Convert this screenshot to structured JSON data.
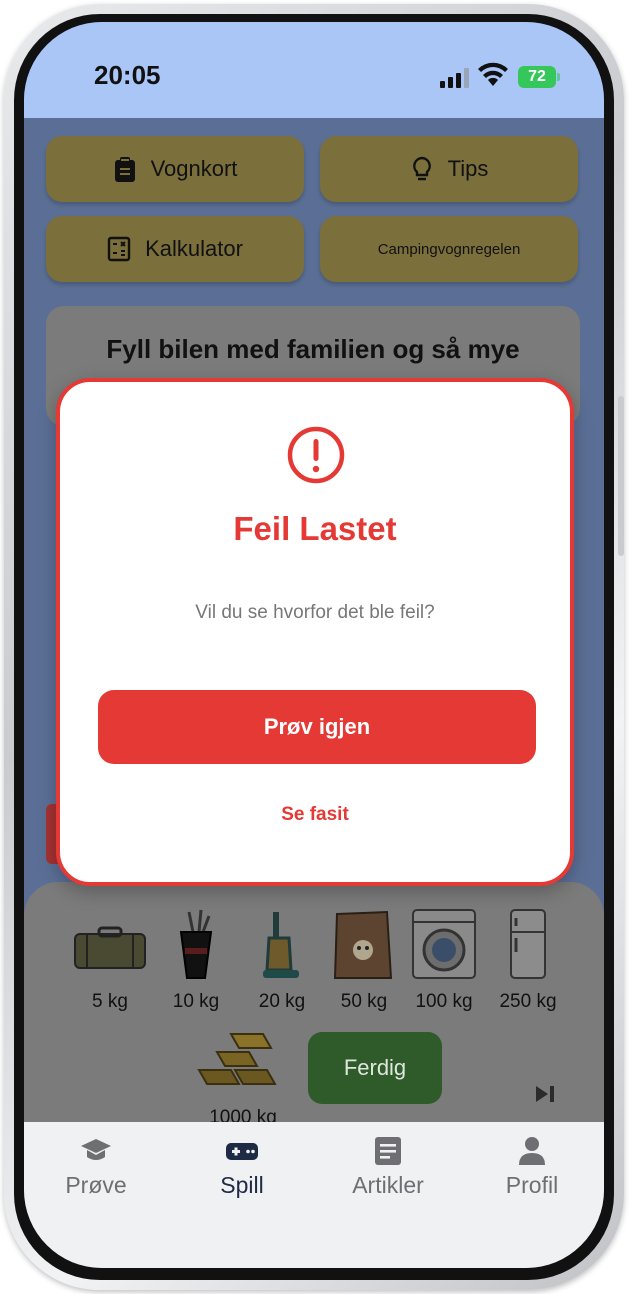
{
  "status_bar": {
    "time": "20:05",
    "battery": "72"
  },
  "tools": {
    "vognkort_label": "Vognkort",
    "tips_label": "Tips",
    "kalkulator_label": "Kalkulator",
    "campingvogn_label": "Campingvognregelen"
  },
  "question": {
    "text": "Fyll bilen med familien og så mye"
  },
  "items": [
    {
      "label": "5 kg",
      "icon": "suitcase-icon"
    },
    {
      "label": "10 kg",
      "icon": "golf-bag-icon"
    },
    {
      "label": "20 kg",
      "icon": "vacuum-cleaner-icon"
    },
    {
      "label": "50 kg",
      "icon": "dog-food-bag-icon"
    },
    {
      "label": "100 kg",
      "icon": "washing-machine-icon"
    },
    {
      "label": "250 kg",
      "icon": "refrigerator-icon"
    },
    {
      "label": "1000 kg",
      "icon": "gold-bars-icon"
    }
  ],
  "done_label": "Ferdig",
  "modal": {
    "title": "Feil Lastet",
    "message": "Vil du se hvorfor det ble feil?",
    "retry_label": "Prøv igjen",
    "answer_label": "Se fasit"
  },
  "tabs": [
    {
      "label": "Prøve",
      "icon": "graduation-cap-icon",
      "active": false
    },
    {
      "label": "Spill",
      "icon": "gamepad-icon",
      "active": true
    },
    {
      "label": "Artikler",
      "icon": "article-icon",
      "active": false
    },
    {
      "label": "Profil",
      "icon": "person-icon",
      "active": false
    }
  ],
  "colors": {
    "accent_red": "#e53935",
    "status_bar": "#a9c6f7",
    "tool_button": "#d9bf5a",
    "done_button": "#3f8f3a"
  }
}
